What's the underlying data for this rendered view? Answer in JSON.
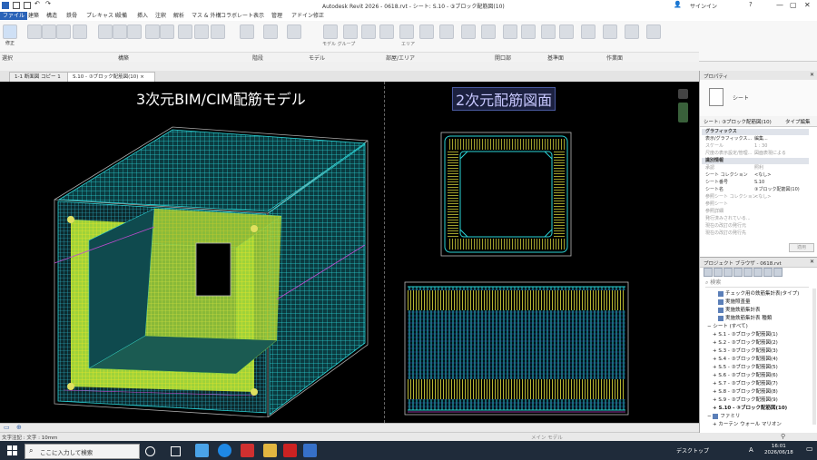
{
  "titlebar": {
    "app_title": "Autodesk Revit 2026 - 0618.rvt - シート: S.10 - ③ブロック配筋図(10)",
    "signin": "サインイン"
  },
  "menu_tabs": [
    "ファイル",
    "建築",
    "構造",
    "鉄骨",
    "プレキャスト",
    "設備",
    "挿入",
    "注釈",
    "解析",
    "マス & 外構",
    "コラボレート",
    "表示",
    "管理",
    "アドイン",
    "修正"
  ],
  "ribbon": {
    "modify_label": "修正",
    "select_label": "選択",
    "panels": [
      "構築",
      "階段",
      "モデル",
      "部屋/エリア",
      "開口部",
      "基準面",
      "作業面"
    ],
    "model_group_label": "モデル グループ",
    "area_label": "エリア"
  },
  "view_tabs": [
    "1-1 断面図 コピー 1",
    "S.10 - ③ブロック配筋図(10)"
  ],
  "canvas": {
    "title_3d": "3次元BIM/CIM配筋モデル",
    "title_2d": "2次元配筋図面"
  },
  "status": {
    "text": "文字注記 : 文字 : 10mm",
    "main_model": "メイン モデル"
  },
  "properties": {
    "title": "プロパティ",
    "type_name": "シート",
    "selector": "シート: ③ブロック配筋図(10)",
    "edit_type": "タイプ編集",
    "apply": "適用",
    "rows": [
      {
        "k": "グラフィックス",
        "v": "",
        "section": true
      },
      {
        "k": "表示/グラフィックス...",
        "v": "編集..."
      },
      {
        "k": "スケール",
        "v": "1 : 30",
        "grey": true
      },
      {
        "k": "尺度の表示設定/管理...",
        "v": "図面表現による",
        "grey": true
      },
      {
        "k": "識別情報",
        "v": "",
        "section": true
      },
      {
        "k": "承認",
        "v": "照利",
        "grey": true
      },
      {
        "k": "シート コレクション",
        "v": "<なし>"
      },
      {
        "k": "シート番号",
        "v": "S.10"
      },
      {
        "k": "シート名",
        "v": "③ブロック配筋図(10)"
      },
      {
        "k": "参照シート コレクション",
        "v": "<なし>",
        "grey": true
      },
      {
        "k": "参照シート",
        "v": "",
        "grey": true
      },
      {
        "k": "参照詳細",
        "v": "",
        "grey": true
      },
      {
        "k": "発行済みされている...",
        "v": "",
        "grey": true
      },
      {
        "k": "現在の改訂の発行元",
        "v": "",
        "grey": true
      },
      {
        "k": "現在の改訂の発行先",
        "v": "",
        "grey": true
      }
    ]
  },
  "browser": {
    "title": "プロジェクト ブラウザ - 0618.rvt",
    "search_placeholder": "検索",
    "items": [
      {
        "label": "チェック用の鉄筋集計表(タイプ)",
        "indent": 3,
        "icon": true
      },
      {
        "label": "実施照査量",
        "indent": 3,
        "icon": true
      },
      {
        "label": "実施鉄筋集計表",
        "indent": 3,
        "icon": true
      },
      {
        "label": "実施鉄筋集計表 種類",
        "indent": 3,
        "icon": true
      },
      {
        "label": "シート (すべて)",
        "indent": 1,
        "prefix": "−"
      },
      {
        "label": "S.1 - ③ブロック配筋図(1)",
        "indent": 2,
        "prefix": "+"
      },
      {
        "label": "S.2 - ③ブロック配筋図(2)",
        "indent": 2,
        "prefix": "+"
      },
      {
        "label": "S.3 - ③ブロック配筋図(3)",
        "indent": 2,
        "prefix": "+"
      },
      {
        "label": "S.4 - ③ブロック配筋図(4)",
        "indent": 2,
        "prefix": "+"
      },
      {
        "label": "S.5 - ③ブロック配筋図(5)",
        "indent": 2,
        "prefix": "+"
      },
      {
        "label": "S.6 - ③ブロック配筋図(6)",
        "indent": 2,
        "prefix": "+"
      },
      {
        "label": "S.7 - ③ブロック配筋図(7)",
        "indent": 2,
        "prefix": "+"
      },
      {
        "label": "S.8 - ③ブロック配筋図(8)",
        "indent": 2,
        "prefix": "+"
      },
      {
        "label": "S.9 - ③ブロック配筋図(9)",
        "indent": 2,
        "prefix": "+"
      },
      {
        "label": "S.10 - ③ブロック配筋図(10)",
        "indent": 2,
        "prefix": "+",
        "bold": true
      },
      {
        "label": "ファミリ",
        "indent": 1,
        "prefix": "−",
        "icon": true
      },
      {
        "label": "カーテン ウォール マリオン",
        "indent": 2,
        "prefix": "+"
      }
    ]
  },
  "taskbar": {
    "search_text": "ここに入力して検索",
    "desktop": "デスクトップ",
    "ime": "A",
    "time": "16:01",
    "date": "2026/06/18"
  }
}
